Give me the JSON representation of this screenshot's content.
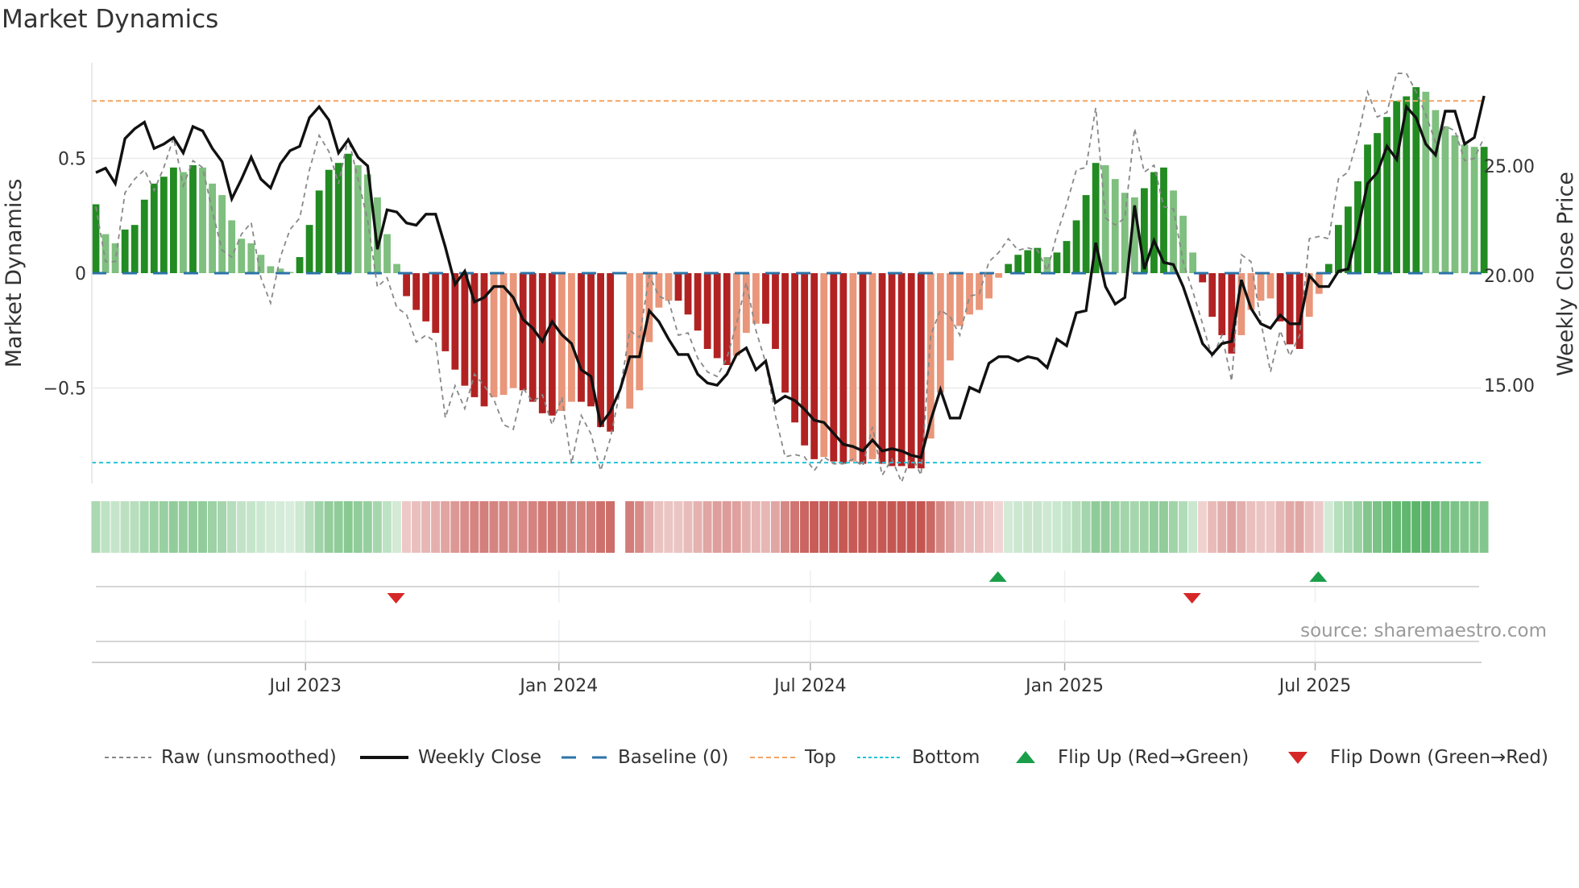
{
  "title": "Market Dynamics",
  "source": "source: sharemaestro.com",
  "legend": {
    "raw": "Raw (unsmoothed)",
    "close": "Weekly Close",
    "baseline": "Baseline (0)",
    "top": "Top",
    "bottom": "Bottom",
    "flip_up": "Flip Up (Red→Green)",
    "flip_down": "Flip Down (Green→Red)"
  },
  "colors": {
    "strong_green": "#228b22",
    "weak_green": "#7fbf7f",
    "strong_red": "#b22222",
    "weak_red": "#e9967a",
    "baseline": "#2b73a8",
    "top": "#f4a460",
    "bottom": "#22c4d8",
    "flip_up": "#1a9e4a",
    "flip_down": "#d62728",
    "close": "#111111",
    "raw": "#888888"
  },
  "chart_data": {
    "type": "bar",
    "title": "Market Dynamics",
    "ylabel": "Market Dynamics",
    "y2label": "Weekly Close Price",
    "ylim": [
      -0.95,
      0.95
    ],
    "y2lim": [
      11.3,
      28.8
    ],
    "yticks": [
      {
        "v": 0.5,
        "label": "0.5"
      },
      {
        "v": 0,
        "label": "0"
      },
      {
        "v": -0.5,
        "label": "−0.5"
      }
    ],
    "y2ticks": [
      {
        "v": 25,
        "label": "25.00"
      },
      {
        "v": 20,
        "label": "20.00"
      },
      {
        "v": 15,
        "label": "15.00"
      }
    ],
    "xticks": [
      {
        "week": 21.6,
        "label": "Jul 2023"
      },
      {
        "week": 47.7,
        "label": "Jan 2024"
      },
      {
        "week": 73.6,
        "label": "Jul 2024"
      },
      {
        "week": 99.8,
        "label": "Jan 2025"
      },
      {
        "week": 125.6,
        "label": "Jul 2025"
      }
    ],
    "top_level": 0.75,
    "bottom_level": -0.825,
    "baseline": 0,
    "momentum": [
      0.3,
      0.17,
      0.13,
      0.19,
      0.21,
      0.32,
      0.39,
      0.42,
      0.46,
      0.44,
      0.47,
      0.46,
      0.39,
      0.34,
      0.23,
      0.15,
      0.13,
      0.08,
      0.03,
      0.02,
      0.005,
      0.07,
      0.21,
      0.36,
      0.45,
      0.48,
      0.52,
      0.47,
      0.43,
      0.33,
      0.17,
      0.04,
      -0.1,
      -0.16,
      -0.21,
      -0.26,
      -0.34,
      -0.42,
      -0.49,
      -0.54,
      -0.58,
      -0.54,
      -0.53,
      -0.5,
      -0.51,
      -0.56,
      -0.61,
      -0.62,
      -0.6,
      -0.56,
      -0.56,
      -0.58,
      -0.67,
      -0.69,
      null,
      -0.59,
      -0.51,
      -0.3,
      -0.15,
      -0.12,
      -0.12,
      -0.18,
      -0.25,
      -0.33,
      -0.37,
      -0.4,
      -0.36,
      -0.26,
      -0.22,
      -0.22,
      -0.33,
      -0.52,
      -0.65,
      -0.75,
      -0.81,
      -0.8,
      -0.82,
      -0.83,
      -0.82,
      -0.83,
      -0.81,
      -0.83,
      -0.84,
      -0.84,
      -0.85,
      -0.85,
      -0.72,
      -0.52,
      -0.38,
      -0.23,
      -0.18,
      -0.16,
      -0.11,
      -0.02,
      0.04,
      0.08,
      0.1,
      0.11,
      0.07,
      0.09,
      0.14,
      0.23,
      0.34,
      0.48,
      0.47,
      0.41,
      0.35,
      0.33,
      0.37,
      0.44,
      0.46,
      0.36,
      0.25,
      0.09,
      -0.04,
      -0.19,
      -0.27,
      -0.35,
      -0.27,
      -0.16,
      -0.12,
      -0.11,
      -0.21,
      -0.31,
      -0.33,
      -0.19,
      -0.09,
      0.04,
      0.21,
      0.29,
      0.4,
      0.56,
      0.61,
      0.68,
      0.75,
      0.77,
      0.81,
      0.79,
      0.71,
      0.64,
      0.6,
      0.56,
      0.55,
      0.55
    ],
    "raw": [
      0.29,
      0.05,
      0.05,
      0.35,
      0.41,
      0.45,
      0.36,
      0.46,
      0.59,
      0.38,
      0.49,
      0.46,
      0.27,
      0.1,
      0.07,
      0.17,
      0.22,
      -0.02,
      -0.13,
      0.07,
      0.19,
      0.24,
      0.45,
      0.6,
      0.53,
      0.39,
      0.59,
      0.41,
      0.23,
      -0.06,
      -0.02,
      -0.15,
      -0.18,
      -0.3,
      -0.27,
      -0.3,
      -0.63,
      -0.49,
      -0.59,
      -0.44,
      -0.49,
      -0.55,
      -0.66,
      -0.68,
      -0.5,
      -0.56,
      -0.53,
      -0.66,
      -0.54,
      -0.83,
      -0.62,
      -0.7,
      -0.86,
      -0.72,
      -0.51,
      -0.25,
      -0.28,
      -0.01,
      -0.1,
      -0.12,
      -0.27,
      -0.26,
      -0.37,
      -0.43,
      -0.45,
      -0.37,
      -0.22,
      -0.04,
      -0.25,
      -0.39,
      -0.62,
      -0.8,
      -0.79,
      -0.8,
      -0.86,
      -0.8,
      -0.83,
      -0.83,
      -0.81,
      -0.84,
      -0.67,
      -0.88,
      -0.81,
      -0.91,
      -0.79,
      -0.88,
      -0.27,
      -0.16,
      -0.19,
      -0.27,
      -0.1,
      -0.09,
      0.05,
      0.09,
      0.15,
      0.1,
      0.11,
      0.1,
      0.01,
      0.17,
      0.3,
      0.45,
      0.46,
      0.72,
      0.24,
      0.21,
      0.24,
      0.63,
      0.44,
      0.47,
      0.29,
      0.28,
      0.05,
      -0.08,
      -0.22,
      -0.37,
      -0.27,
      -0.47,
      0.08,
      0.05,
      -0.21,
      -0.43,
      -0.25,
      -0.36,
      -0.27,
      0.15,
      0.16,
      0.15,
      0.41,
      0.44,
      0.59,
      0.79,
      0.68,
      0.7,
      0.87,
      0.87,
      0.79,
      0.69,
      0.57,
      0.64,
      0.62,
      0.49,
      0.5,
      0.59
    ],
    "close": [
      24.7,
      24.9,
      24.2,
      26.25,
      26.7,
      27.0,
      25.8,
      26.0,
      26.3,
      25.6,
      26.8,
      26.6,
      25.8,
      25.2,
      23.5,
      24.4,
      25.4,
      24.4,
      24.0,
      25.1,
      25.7,
      25.9,
      27.2,
      27.7,
      27.1,
      25.6,
      26.2,
      25.4,
      25.0,
      21.2,
      23.0,
      22.9,
      22.4,
      22.3,
      22.8,
      22.8,
      21.3,
      19.6,
      20.2,
      18.8,
      19.0,
      19.5,
      19.5,
      19.0,
      18.0,
      17.6,
      17.0,
      17.9,
      17.3,
      16.9,
      15.7,
      15.4,
      13.2,
      13.8,
      14.8,
      16.3,
      16.3,
      18.4,
      17.9,
      17.1,
      16.4,
      16.4,
      15.5,
      15.1,
      15.0,
      15.5,
      16.4,
      16.7,
      15.7,
      16.1,
      14.2,
      14.5,
      14.3,
      13.9,
      13.4,
      13.3,
      12.8,
      12.3,
      12.2,
      12.0,
      12.5,
      12.0,
      12.1,
      12.0,
      11.8,
      11.7,
      13.4,
      14.8,
      13.5,
      13.5,
      14.9,
      14.7,
      16.0,
      16.3,
      16.3,
      16.1,
      16.3,
      16.2,
      15.8,
      17.1,
      16.8,
      18.3,
      18.4,
      21.5,
      19.5,
      18.7,
      19.0,
      23.2,
      20.3,
      21.6,
      20.6,
      20.5,
      19.5,
      18.2,
      16.9,
      16.4,
      16.9,
      17.0,
      19.8,
      18.5,
      17.8,
      17.6,
      18.2,
      17.8,
      17.8,
      20.0,
      19.5,
      19.5,
      20.2,
      20.3,
      22.1,
      24.2,
      24.7,
      25.9,
      25.3,
      27.7,
      27.2,
      26.0,
      25.5,
      27.5,
      27.5,
      26.0,
      26.3,
      28.2
    ],
    "flips": [
      {
        "week": 32,
        "dir": "down"
      },
      {
        "week": 94,
        "dir": "up"
      },
      {
        "week": 114,
        "dir": "down"
      },
      {
        "week": 127,
        "dir": "up"
      }
    ],
    "legend_position": "bottom"
  }
}
